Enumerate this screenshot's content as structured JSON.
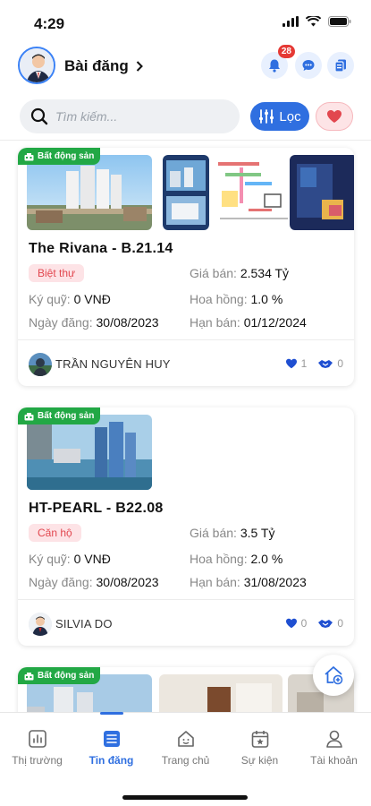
{
  "status": {
    "time": "4:29"
  },
  "header": {
    "title": "Bài đăng",
    "notification_count": "28"
  },
  "search": {
    "placeholder": "Tìm kiếm...",
    "value": "",
    "filter_label": "Lọc"
  },
  "listings": [
    {
      "tag": "Bất động sản",
      "title": "The Rivana - B.21.14",
      "type": "Biệt thự",
      "price_label": "Giá bán:",
      "price": "2.534 Tỷ",
      "deposit_label": "Ký quỹ:",
      "deposit": "0 VNĐ",
      "commission_label": "Hoa hồng:",
      "commission": "1.0 %",
      "posted_label": "Ngày đăng:",
      "posted": "30/08/2023",
      "deadline_label": "Hạn bán:",
      "deadline": "01/12/2024",
      "agent": "TRẦN NGUYÊN HUY",
      "likes": "1",
      "shares": "0"
    },
    {
      "tag": "Bất động sản",
      "title": "HT-PEARL - B22.08",
      "type": "Căn hộ",
      "price_label": "Giá bán:",
      "price": "3.5 Tỷ",
      "deposit_label": "Ký quỹ:",
      "deposit": "0 VNĐ",
      "commission_label": "Hoa hồng:",
      "commission": "2.0 %",
      "posted_label": "Ngày đăng:",
      "posted": "30/08/2023",
      "deadline_label": "Hạn bán:",
      "deadline": "31/08/2023",
      "agent": "SILVIA DO",
      "likes": "0",
      "shares": "0"
    },
    {
      "tag": "Bất động sản"
    }
  ],
  "tabs": [
    {
      "label": "Thị trường",
      "icon": "chart-icon"
    },
    {
      "label": "Tin đăng",
      "icon": "list-icon",
      "active": true
    },
    {
      "label": "Trang chủ",
      "icon": "home-face-icon"
    },
    {
      "label": "Sự kiện",
      "icon": "calendar-star-icon"
    },
    {
      "label": "Tài khoản",
      "icon": "user-icon"
    }
  ],
  "colors": {
    "primary": "#2f6fe0",
    "tag_green": "#22a845",
    "chip_pink": "#fde3e6",
    "chip_text": "#e2474f",
    "badge_red": "#e53935"
  }
}
